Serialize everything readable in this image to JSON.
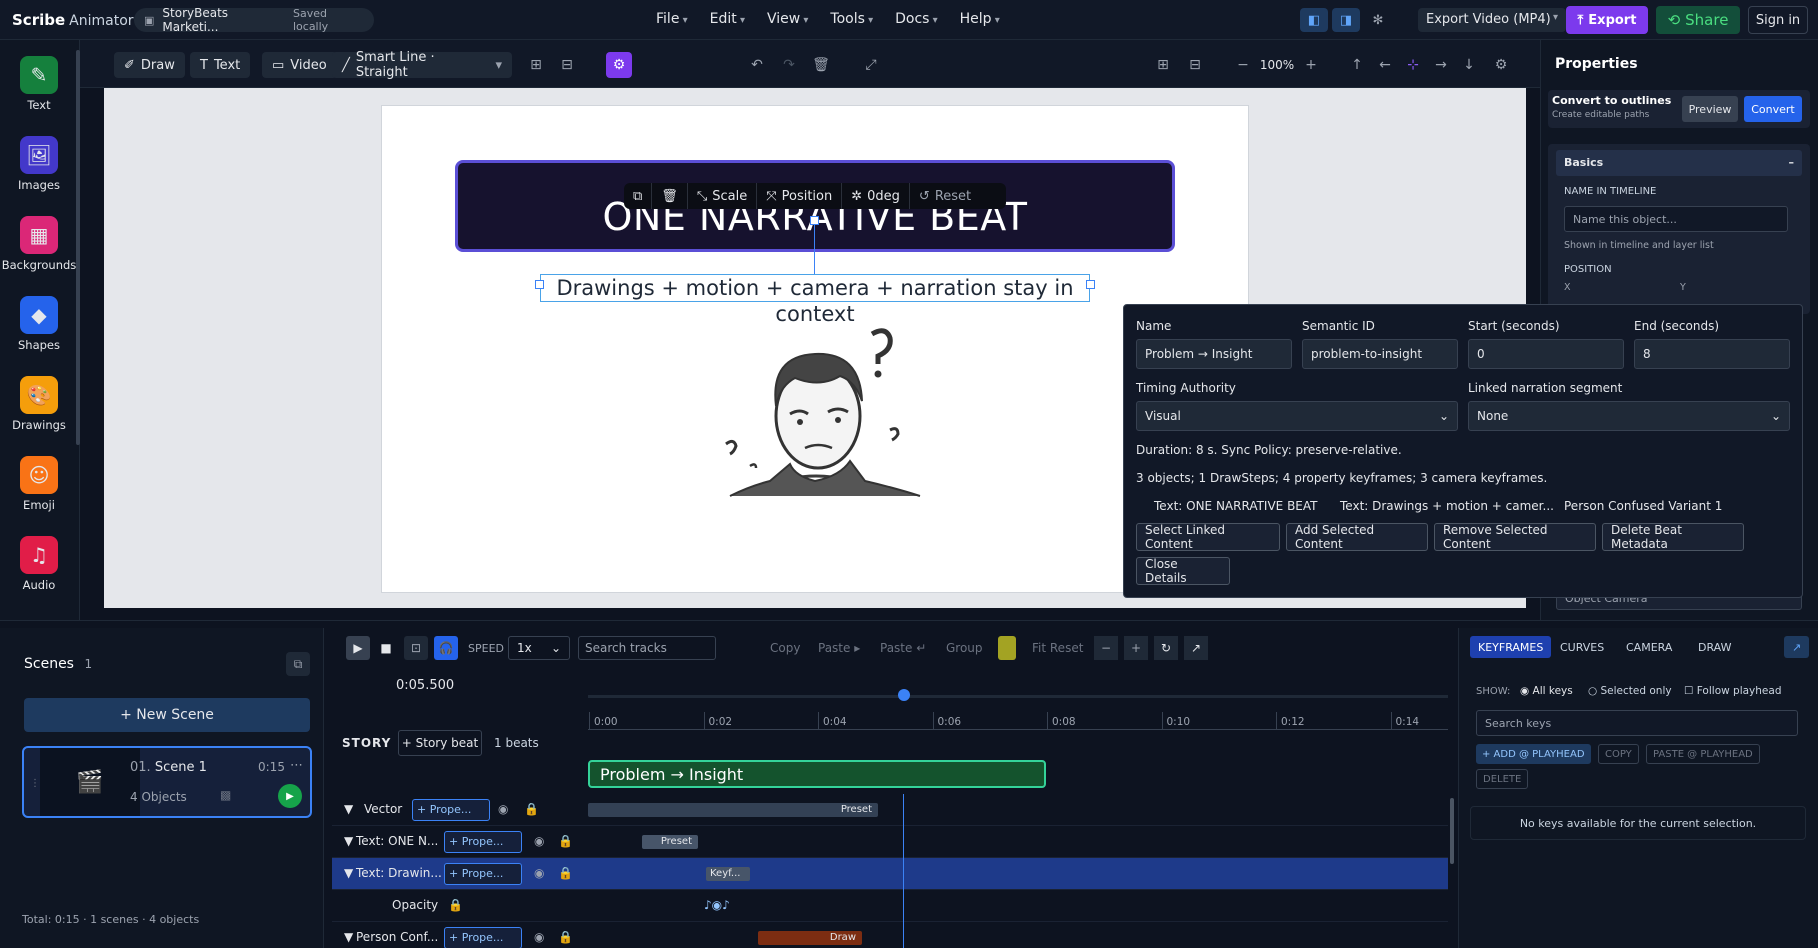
{
  "app": {
    "brand": "Scribe",
    "brand_sub": "Animator",
    "project": "StoryBeats Marketi...",
    "saved": "Saved locally"
  },
  "menu": [
    "File",
    "Edit",
    "View",
    "Tools",
    "Docs",
    "Help"
  ],
  "topbar": {
    "export_select": "Export Video (MP4)",
    "export": "Export",
    "share": "Share",
    "signin": "Sign in"
  },
  "left_tools": [
    {
      "label": "Text",
      "icon": "text-icon"
    },
    {
      "label": "Images",
      "icon": "images-icon"
    },
    {
      "label": "Backgrounds",
      "icon": "backgrounds-icon"
    },
    {
      "label": "Shapes",
      "icon": "shapes-icon"
    },
    {
      "label": "Drawings",
      "icon": "drawings-icon"
    },
    {
      "label": "Emoji",
      "icon": "emoji-icon"
    },
    {
      "label": "Audio",
      "icon": "audio-icon"
    }
  ],
  "canvas_toolbar": {
    "draw": "Draw",
    "text": "Text",
    "video": "Video",
    "line": "Smart Line · Straight",
    "zoom": "100%"
  },
  "stage": {
    "banner_text": "ONE NARRATIVE BEAT",
    "subtitle": "Drawings + motion + camera + narration stay in context",
    "floatbar": {
      "scale": "Scale",
      "position": "Position",
      "rotation": "0deg",
      "reset": "Reset"
    }
  },
  "properties": {
    "title": "Properties",
    "convert_title": "Convert to outlines",
    "convert_sub": "Create editable paths",
    "preview": "Preview",
    "convert": "Convert",
    "basics": "Basics",
    "name_label": "NAME IN TIMELINE",
    "name_placeholder": "Name this object...",
    "name_hint": "Shown in timeline and layer list",
    "position_label": "POSITION",
    "x_label": "X",
    "y_label": "Y",
    "camera_select": "Object Camera"
  },
  "popup": {
    "name_label": "Name",
    "name_value": "Problem → Insight",
    "semantic_label": "Semantic ID",
    "semantic_value": "problem-to-insight",
    "start_label": "Start (seconds)",
    "start_value": "0",
    "end_label": "End (seconds)",
    "end_value": "8",
    "timing_label": "Timing Authority",
    "timing_value": "Visual",
    "narration_label": "Linked narration segment",
    "narration_value": "None",
    "duration_text": "Duration: 8 s. Sync Policy: preserve-relative.",
    "summary_text": "3 objects; 1 DrawSteps; 4 property keyframes; 3 camera keyframes.",
    "items": [
      "Text: ONE NARRATIVE BEAT",
      "Text: Drawings + motion + camer...",
      "Person Confused Variant 1"
    ],
    "buttons": [
      "Select Linked Content",
      "Add Selected Content",
      "Remove Selected Content",
      "Delete Beat Metadata"
    ],
    "close": "Close Details"
  },
  "scenes": {
    "title": "Scenes",
    "count": "1",
    "new_scene": "+ New Scene",
    "scene_num": "01.",
    "scene_name": "Scene 1",
    "scene_time": "0:15",
    "scene_objects": "4 Objects",
    "footer": "Total: 0:15 · 1 scenes · 4 objects"
  },
  "timeline": {
    "speed_label": "SPEED",
    "speed_value": "1x",
    "search_placeholder": "Search tracks",
    "tools": [
      "Copy",
      "Paste ▸",
      "Paste ↵",
      "Group",
      "Fit Reset"
    ],
    "current_time": "0:05.500",
    "ticks": [
      "0:00",
      "0:02",
      "0:04",
      "0:06",
      "0:08",
      "0:10",
      "0:12",
      "0:14"
    ],
    "story_label": "STORY",
    "story_beat_btn": "+ Story beat",
    "beats_count": "1 beats",
    "beat_name": "Problem → Insight",
    "tracks": [
      {
        "name": "Vector",
        "prop": "Prope...",
        "clip": "Preset"
      },
      {
        "name": "Text: ONE N...",
        "prop": "Prope...",
        "clip": "Preset"
      },
      {
        "name": "Text: Drawin...",
        "prop": "Prope...",
        "clip": "Keyf..."
      },
      {
        "name": "Opacity",
        "prop": "",
        "clip": ""
      },
      {
        "name": "Person Conf...",
        "prop": "Prope...",
        "clip": "Draw"
      }
    ]
  },
  "keyframes": {
    "tabs": [
      "KEYFRAMES",
      "CURVES",
      "CAMERA",
      "DRAW"
    ],
    "show_label": "SHOW:",
    "opt_all": "All keys",
    "opt_selected": "Selected only",
    "opt_follow": "Follow playhead",
    "search_placeholder": "Search keys",
    "add": "+ ADD @ PLAYHEAD",
    "copy": "COPY",
    "paste": "PASTE @ PLAYHEAD",
    "delete": "DELETE",
    "empty": "No keys available for the current selection."
  },
  "colors": {
    "accent": "#3b82f6",
    "export": "#7c3aed",
    "share": "#4ade80",
    "beat": "#14532d"
  }
}
